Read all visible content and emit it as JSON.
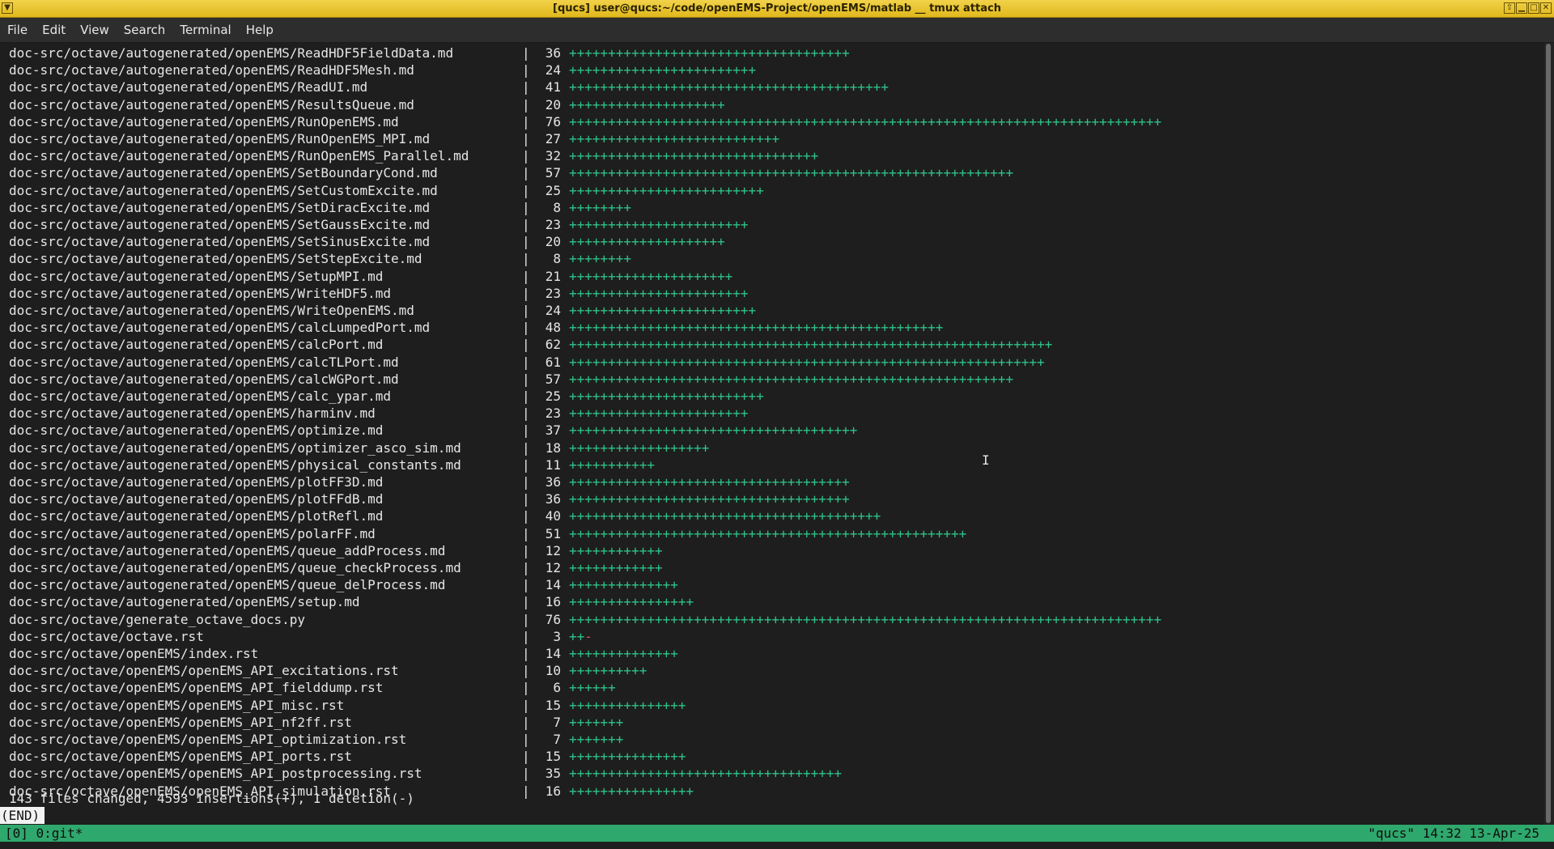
{
  "window": {
    "title": "[qucs] user@qucs:~/code/openEMS-Project/openEMS/matlab __ tmux attach",
    "menu_icon": "▼",
    "controls": [
      "⇧",
      "▁",
      "□",
      "✕"
    ]
  },
  "menu": [
    "File",
    "Edit",
    "View",
    "Search",
    "Terminal",
    "Help"
  ],
  "diffstat": [
    {
      "file": "doc-src/octave/autogenerated/openEMS/ReadHDF5FieldData.md",
      "count": "36",
      "plus": "++++++++++++++++++++++++++++++++++++",
      "minus": ""
    },
    {
      "file": "doc-src/octave/autogenerated/openEMS/ReadHDF5Mesh.md",
      "count": "24",
      "plus": "++++++++++++++++++++++++",
      "minus": ""
    },
    {
      "file": "doc-src/octave/autogenerated/openEMS/ReadUI.md",
      "count": "41",
      "plus": "+++++++++++++++++++++++++++++++++++++++++",
      "minus": ""
    },
    {
      "file": "doc-src/octave/autogenerated/openEMS/ResultsQueue.md",
      "count": "20",
      "plus": "++++++++++++++++++++",
      "minus": ""
    },
    {
      "file": "doc-src/octave/autogenerated/openEMS/RunOpenEMS.md",
      "count": "76",
      "plus": "++++++++++++++++++++++++++++++++++++++++++++++++++++++++++++++++++++++++++++",
      "minus": ""
    },
    {
      "file": "doc-src/octave/autogenerated/openEMS/RunOpenEMS_MPI.md",
      "count": "27",
      "plus": "+++++++++++++++++++++++++++",
      "minus": ""
    },
    {
      "file": "doc-src/octave/autogenerated/openEMS/RunOpenEMS_Parallel.md",
      "count": "32",
      "plus": "++++++++++++++++++++++++++++++++",
      "minus": ""
    },
    {
      "file": "doc-src/octave/autogenerated/openEMS/SetBoundaryCond.md",
      "count": "57",
      "plus": "+++++++++++++++++++++++++++++++++++++++++++++++++++++++++",
      "minus": ""
    },
    {
      "file": "doc-src/octave/autogenerated/openEMS/SetCustomExcite.md",
      "count": "25",
      "plus": "+++++++++++++++++++++++++",
      "minus": ""
    },
    {
      "file": "doc-src/octave/autogenerated/openEMS/SetDiracExcite.md",
      "count": "8",
      "plus": "++++++++",
      "minus": ""
    },
    {
      "file": "doc-src/octave/autogenerated/openEMS/SetGaussExcite.md",
      "count": "23",
      "plus": "+++++++++++++++++++++++",
      "minus": ""
    },
    {
      "file": "doc-src/octave/autogenerated/openEMS/SetSinusExcite.md",
      "count": "20",
      "plus": "++++++++++++++++++++",
      "minus": ""
    },
    {
      "file": "doc-src/octave/autogenerated/openEMS/SetStepExcite.md",
      "count": "8",
      "plus": "++++++++",
      "minus": ""
    },
    {
      "file": "doc-src/octave/autogenerated/openEMS/SetupMPI.md",
      "count": "21",
      "plus": "+++++++++++++++++++++",
      "minus": ""
    },
    {
      "file": "doc-src/octave/autogenerated/openEMS/WriteHDF5.md",
      "count": "23",
      "plus": "+++++++++++++++++++++++",
      "minus": ""
    },
    {
      "file": "doc-src/octave/autogenerated/openEMS/WriteOpenEMS.md",
      "count": "24",
      "plus": "++++++++++++++++++++++++",
      "minus": ""
    },
    {
      "file": "doc-src/octave/autogenerated/openEMS/calcLumpedPort.md",
      "count": "48",
      "plus": "++++++++++++++++++++++++++++++++++++++++++++++++",
      "minus": ""
    },
    {
      "file": "doc-src/octave/autogenerated/openEMS/calcPort.md",
      "count": "62",
      "plus": "++++++++++++++++++++++++++++++++++++++++++++++++++++++++++++++",
      "minus": ""
    },
    {
      "file": "doc-src/octave/autogenerated/openEMS/calcTLPort.md",
      "count": "61",
      "plus": "+++++++++++++++++++++++++++++++++++++++++++++++++++++++++++++",
      "minus": ""
    },
    {
      "file": "doc-src/octave/autogenerated/openEMS/calcWGPort.md",
      "count": "57",
      "plus": "+++++++++++++++++++++++++++++++++++++++++++++++++++++++++",
      "minus": ""
    },
    {
      "file": "doc-src/octave/autogenerated/openEMS/calc_ypar.md",
      "count": "25",
      "plus": "+++++++++++++++++++++++++",
      "minus": ""
    },
    {
      "file": "doc-src/octave/autogenerated/openEMS/harminv.md",
      "count": "23",
      "plus": "+++++++++++++++++++++++",
      "minus": ""
    },
    {
      "file": "doc-src/octave/autogenerated/openEMS/optimize.md",
      "count": "37",
      "plus": "+++++++++++++++++++++++++++++++++++++",
      "minus": ""
    },
    {
      "file": "doc-src/octave/autogenerated/openEMS/optimizer_asco_sim.md",
      "count": "18",
      "plus": "++++++++++++++++++",
      "minus": ""
    },
    {
      "file": "doc-src/octave/autogenerated/openEMS/physical_constants.md",
      "count": "11",
      "plus": "+++++++++++",
      "minus": ""
    },
    {
      "file": "doc-src/octave/autogenerated/openEMS/plotFF3D.md",
      "count": "36",
      "plus": "++++++++++++++++++++++++++++++++++++",
      "minus": ""
    },
    {
      "file": "doc-src/octave/autogenerated/openEMS/plotFFdB.md",
      "count": "36",
      "plus": "++++++++++++++++++++++++++++++++++++",
      "minus": ""
    },
    {
      "file": "doc-src/octave/autogenerated/openEMS/plotRefl.md",
      "count": "40",
      "plus": "++++++++++++++++++++++++++++++++++++++++",
      "minus": ""
    },
    {
      "file": "doc-src/octave/autogenerated/openEMS/polarFF.md",
      "count": "51",
      "plus": "+++++++++++++++++++++++++++++++++++++++++++++++++++",
      "minus": ""
    },
    {
      "file": "doc-src/octave/autogenerated/openEMS/queue_addProcess.md",
      "count": "12",
      "plus": "++++++++++++",
      "minus": ""
    },
    {
      "file": "doc-src/octave/autogenerated/openEMS/queue_checkProcess.md",
      "count": "12",
      "plus": "++++++++++++",
      "minus": ""
    },
    {
      "file": "doc-src/octave/autogenerated/openEMS/queue_delProcess.md",
      "count": "14",
      "plus": "++++++++++++++",
      "minus": ""
    },
    {
      "file": "doc-src/octave/autogenerated/openEMS/setup.md",
      "count": "16",
      "plus": "++++++++++++++++",
      "minus": ""
    },
    {
      "file": "doc-src/octave/generate_octave_docs.py",
      "count": "76",
      "plus": "++++++++++++++++++++++++++++++++++++++++++++++++++++++++++++++++++++++++++++",
      "minus": ""
    },
    {
      "file": "doc-src/octave/octave.rst",
      "count": "3",
      "plus": "++",
      "minus": "-"
    },
    {
      "file": "doc-src/octave/openEMS/index.rst",
      "count": "14",
      "plus": "++++++++++++++",
      "minus": ""
    },
    {
      "file": "doc-src/octave/openEMS/openEMS_API_excitations.rst",
      "count": "10",
      "plus": "++++++++++",
      "minus": ""
    },
    {
      "file": "doc-src/octave/openEMS/openEMS_API_fielddump.rst",
      "count": "6",
      "plus": "++++++",
      "minus": ""
    },
    {
      "file": "doc-src/octave/openEMS/openEMS_API_misc.rst",
      "count": "15",
      "plus": "+++++++++++++++",
      "minus": ""
    },
    {
      "file": "doc-src/octave/openEMS/openEMS_API_nf2ff.rst",
      "count": "7",
      "plus": "+++++++",
      "minus": ""
    },
    {
      "file": "doc-src/octave/openEMS/openEMS_API_optimization.rst",
      "count": "7",
      "plus": "+++++++",
      "minus": ""
    },
    {
      "file": "doc-src/octave/openEMS/openEMS_API_ports.rst",
      "count": "15",
      "plus": "+++++++++++++++",
      "minus": ""
    },
    {
      "file": "doc-src/octave/openEMS/openEMS_API_postprocessing.rst",
      "count": "35",
      "plus": "+++++++++++++++++++++++++++++++++++",
      "minus": ""
    },
    {
      "file": "doc-src/octave/openEMS/openEMS_API_simulation.rst",
      "count": "16",
      "plus": "++++++++++++++++",
      "minus": ""
    }
  ],
  "pipe_char": "|",
  "summary": "143 files changed, 4593 insertions(+), 1 deletion(-)",
  "pager_end": "(END)",
  "cursor_glyph": "I",
  "status": {
    "left": "[0] 0:git*",
    "right": "\"qucs\" 14:32 13-Apr-25"
  },
  "colors": {
    "title_bg": "#e9c52e",
    "terminal_bg": "#1e1e1e",
    "terminal_fg": "#e6e6e6",
    "plus": "#2fc38a",
    "minus": "#e5484d",
    "statusbar_bg": "#2fa86d"
  }
}
